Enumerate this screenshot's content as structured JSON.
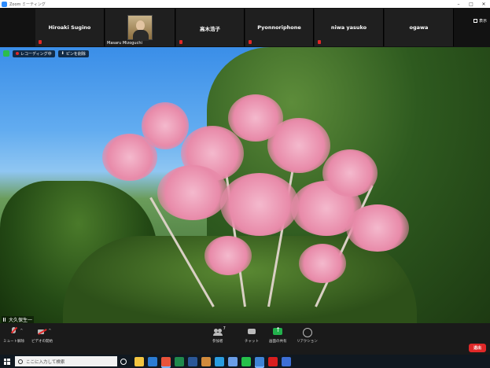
{
  "window": {
    "title": "Zoom ミーティング"
  },
  "gallery": {
    "participants": [
      {
        "name": "Hiroaki Sugino",
        "muted": true
      },
      {
        "name": "Masaru Mizoguchi",
        "muted": false,
        "video": true
      },
      {
        "name": "高木浩子",
        "muted": true
      },
      {
        "name": "Pyonnoriphone",
        "muted": true
      },
      {
        "name": "niwa yasuko",
        "muted": true
      },
      {
        "name": "ogawa",
        "muted": false
      }
    ],
    "view_label": "表示"
  },
  "main_video": {
    "recording_label": "レコーディング中",
    "pin_label": "ピンを削除",
    "speaker_name": "大久保生一"
  },
  "controls": {
    "mute_label": "ミュート解除",
    "video_label": "ビデオの開始",
    "participants_label": "参加者",
    "participants_count": "7",
    "chat_label": "チャット",
    "share_label": "画面の共有",
    "reaction_label": "リアクション",
    "leave_label": "退出"
  },
  "taskbar": {
    "search_placeholder": "ここに入力して検索",
    "apps": [
      {
        "icon": "file-explorer-icon",
        "color": "#f2c440"
      },
      {
        "icon": "mail-icon",
        "color": "#2b7cd3"
      },
      {
        "icon": "zoom-icon",
        "color": "#e8533a"
      },
      {
        "icon": "excel-icon",
        "color": "#1f8a4c"
      },
      {
        "icon": "word-icon",
        "color": "#2b5797"
      },
      {
        "icon": "app-icon",
        "color": "#d08a3c"
      },
      {
        "icon": "edge-icon",
        "color": "#2a9de0"
      },
      {
        "icon": "store-icon",
        "color": "#6a9ee8"
      },
      {
        "icon": "line-icon",
        "color": "#25c04a"
      },
      {
        "icon": "camera-app-icon",
        "color": "#3f84d6"
      },
      {
        "icon": "pdf-icon",
        "color": "#d81e1e"
      },
      {
        "icon": "photos-icon",
        "color": "#3d6fd6"
      }
    ]
  }
}
